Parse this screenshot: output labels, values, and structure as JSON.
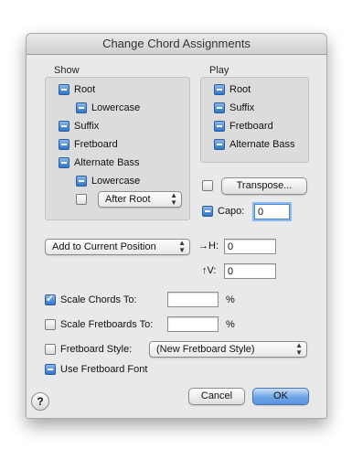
{
  "window": {
    "title": "Change Chord Assignments"
  },
  "show": {
    "label": "Show",
    "root": "Root",
    "root_lowercase": "Lowercase",
    "suffix": "Suffix",
    "fretboard": "Fretboard",
    "alternate_bass": "Alternate Bass",
    "bass_lowercase": "Lowercase",
    "after_root_select": "After Root"
  },
  "play": {
    "label": "Play",
    "root": "Root",
    "suffix": "Suffix",
    "fretboard": "Fretboard",
    "alternate_bass": "Alternate Bass"
  },
  "transpose": {
    "button": "Transpose..."
  },
  "capo": {
    "label": "Capo:",
    "value": "0"
  },
  "position": {
    "select": "Add to Current Position",
    "h_label": "→H:",
    "h_value": "0",
    "v_label": "↑V:",
    "v_value": "0"
  },
  "scale_chords": {
    "label": "Scale Chords To:",
    "value": "",
    "unit": "%"
  },
  "scale_fretboards": {
    "label": "Scale Fretboards To:",
    "value": "",
    "unit": "%"
  },
  "fretboard_style": {
    "label": "Fretboard Style:",
    "select": "(New Fretboard Style)"
  },
  "use_font": {
    "label": "Use Fretboard Font"
  },
  "buttons": {
    "help": "?",
    "cancel": "Cancel",
    "ok": "OK"
  },
  "colors": {
    "accent": "#3a7bd5",
    "dialog_bg": "#e9e9e9"
  }
}
